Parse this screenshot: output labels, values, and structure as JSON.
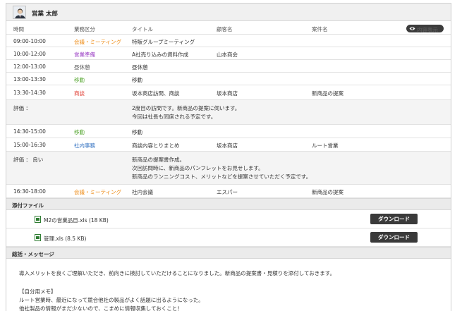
{
  "user": {
    "name": "営業 太郎"
  },
  "columns": {
    "time": "時間",
    "category": "業務区分",
    "title": "タイトル",
    "client": "顧客名",
    "case": "案件名"
  },
  "show_content_button": "内容表示",
  "colors": {
    "meeting": "#ee8a12",
    "sales_prep": "#9b3fc4",
    "move": "#55a630",
    "negotiation": "#e03c31",
    "office": "#2f6fc0"
  },
  "rows": [
    {
      "time": "09:00-10:00",
      "category": "会議・ミーティング",
      "title": "特販グループミーティング",
      "client": "",
      "case": ""
    },
    {
      "time": "10:00-12:00",
      "category": "営業準備",
      "title": "A社売り込みの資料作成",
      "client": "山本商会",
      "case": ""
    },
    {
      "time": "12:00-13:00",
      "category": "昼休憩",
      "title": "昼休憩",
      "client": "",
      "case": ""
    },
    {
      "time": "13:00-13:30",
      "category": "移動",
      "title": "移動",
      "client": "",
      "case": ""
    },
    {
      "time": "13:30-14:30",
      "category": "商談",
      "title": "坂本商店訪問、商談",
      "client": "坂本商店",
      "case": "新商品の提案"
    },
    {
      "time": "14:30-15:00",
      "category": "移動",
      "title": "移動",
      "client": "",
      "case": ""
    },
    {
      "time": "15:00-16:30",
      "category": "社内事務",
      "title": "商談内容とりまとめ",
      "client": "坂本商店",
      "case": "ルート営業"
    },
    {
      "time": "16:30-18:00",
      "category": "会議・ミーティング",
      "title": "社内会議",
      "client": "エスパー",
      "case": "新商品の提案"
    }
  ],
  "evaluations": [
    {
      "label": "評価 ：",
      "lines": [
        "2度目の訪問です。新商品の提案に伺います。",
        "今回は社長も同席される予定です。"
      ]
    },
    {
      "label": "評価 ： 良い",
      "lines": [
        "新商品の提案書作成。",
        "次回訪問時に、新商品のパンフレットをお見せします。",
        "新商品のランニングコスト、メリットなどを提案させていただく予定です。"
      ]
    }
  ],
  "attachments_title": "添付ファイル",
  "attachments": [
    {
      "name": "M2の営業品目.xls (18 KB)",
      "button": "ダウンロード"
    },
    {
      "name": "管理.xls (8.5 KB)",
      "button": "ダウンロード"
    }
  ],
  "summary_title": "総括・メッセージ",
  "summary_lines": [
    "導入メリットを良くご理解いただき、前向きに検討していただけることになりました。新商品の提案書・見積りを添付しておきます。",
    "",
    "【自分用メモ】",
    "ルート営業時、最近になって競合他社の製品がよく話題に出るようになった。",
    "他社製品の情報がまだ少ないので、こまめに情報収集しておくこと！"
  ]
}
